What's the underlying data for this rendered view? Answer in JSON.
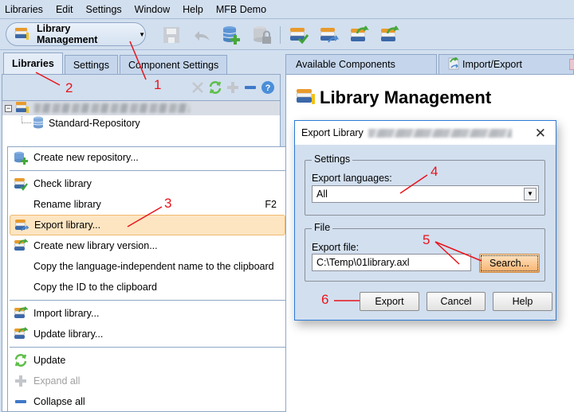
{
  "menubar": {
    "items": [
      {
        "label": "Libraries",
        "mnemonic": "L"
      },
      {
        "label": "Edit",
        "mnemonic": "E"
      },
      {
        "label": "Settings",
        "mnemonic": "S"
      },
      {
        "label": "Window",
        "mnemonic": "W"
      },
      {
        "label": "Help",
        "mnemonic": "H"
      },
      {
        "label": "MFB Demo",
        "mnemonic": ""
      }
    ]
  },
  "toolbar": {
    "perspective_label": "Library Management",
    "buttons": [
      {
        "name": "save",
        "icon": "floppy-disk-icon",
        "enabled": false
      },
      {
        "name": "undo",
        "icon": "undo-icon",
        "enabled": false
      },
      {
        "name": "add-repository",
        "icon": "database-add-icon",
        "enabled": true
      },
      {
        "name": "lock-repository",
        "icon": "database-lock-icon",
        "enabled": false
      },
      {
        "name": "check-library",
        "icon": "library-check-icon",
        "enabled": true
      },
      {
        "name": "export-library",
        "icon": "library-export-icon",
        "enabled": true
      },
      {
        "name": "import-library",
        "icon": "library-import-icon",
        "enabled": true
      },
      {
        "name": "update-library",
        "icon": "library-update-icon",
        "enabled": true
      }
    ]
  },
  "left_tabs": [
    {
      "label": "Libraries",
      "active": true
    },
    {
      "label": "Settings",
      "active": false
    },
    {
      "label": "Component Settings",
      "active": false
    }
  ],
  "tree_tools": [
    "delete-icon",
    "refresh-icon",
    "expand-icon",
    "collapse-icon",
    "help-icon"
  ],
  "tree": {
    "root_label_blurred": true,
    "children": [
      {
        "label": "Standard-Repository",
        "icon": "database-icon"
      }
    ]
  },
  "context_menu": {
    "items": [
      {
        "label": "Create new repository...",
        "icon": "database-add-icon",
        "shortcut": "",
        "highlighted": false,
        "disabled": false,
        "sep_after": true
      },
      {
        "label": "Check library",
        "icon": "library-check-icon",
        "shortcut": "",
        "highlighted": false,
        "disabled": false,
        "sep_after": false
      },
      {
        "label": "Rename library",
        "icon": "",
        "shortcut": "F2",
        "highlighted": false,
        "disabled": false,
        "sep_after": false
      },
      {
        "label": "Export library...",
        "icon": "library-export-icon",
        "shortcut": "",
        "highlighted": true,
        "disabled": false,
        "sep_after": false
      },
      {
        "label": "Create new library version...",
        "icon": "library-version-icon",
        "shortcut": "",
        "highlighted": false,
        "disabled": false,
        "sep_after": false
      },
      {
        "label": "Copy the language-independent name to the clipboard",
        "icon": "",
        "shortcut": "",
        "highlighted": false,
        "disabled": false,
        "sep_after": false
      },
      {
        "label": "Copy the ID to the clipboard",
        "icon": "",
        "shortcut": "",
        "highlighted": false,
        "disabled": false,
        "sep_after": true
      },
      {
        "label": "Import library...",
        "icon": "library-import-icon",
        "shortcut": "",
        "highlighted": false,
        "disabled": false,
        "sep_after": false
      },
      {
        "label": "Update library...",
        "icon": "library-update-icon",
        "shortcut": "",
        "highlighted": false,
        "disabled": false,
        "sep_after": true
      },
      {
        "label": "Update",
        "icon": "refresh-icon",
        "shortcut": "",
        "highlighted": false,
        "disabled": false,
        "sep_after": false
      },
      {
        "label": "Expand all",
        "icon": "expand-icon",
        "shortcut": "",
        "highlighted": false,
        "disabled": true,
        "sep_after": false
      },
      {
        "label": "Collapse all",
        "icon": "collapse-icon",
        "shortcut": "",
        "highlighted": false,
        "disabled": false,
        "sep_after": false
      }
    ]
  },
  "right_tabs": [
    {
      "label": "Available Components",
      "icon": ""
    },
    {
      "label": "Import/Export",
      "icon": "import-export-icon"
    }
  ],
  "right_panel": {
    "title": "Library Management"
  },
  "dialog": {
    "title": "Export Library",
    "title_suffix_blurred": true,
    "settings_group": "Settings",
    "languages_label": "Export languages:",
    "languages_value": "All",
    "file_group": "File",
    "file_label": "Export file:",
    "file_value": "C:\\Temp\\01library.axl",
    "search_label": "Search...",
    "export_label": "Export",
    "cancel_label": "Cancel",
    "help_label": "Help"
  },
  "annotations": [
    "1",
    "2",
    "3",
    "4",
    "5",
    "6"
  ],
  "colors": {
    "annotation": "#e8141b",
    "highlight": "#fde5c2",
    "background": "#d2dfef",
    "dialog_border": "#2b7bd6"
  }
}
